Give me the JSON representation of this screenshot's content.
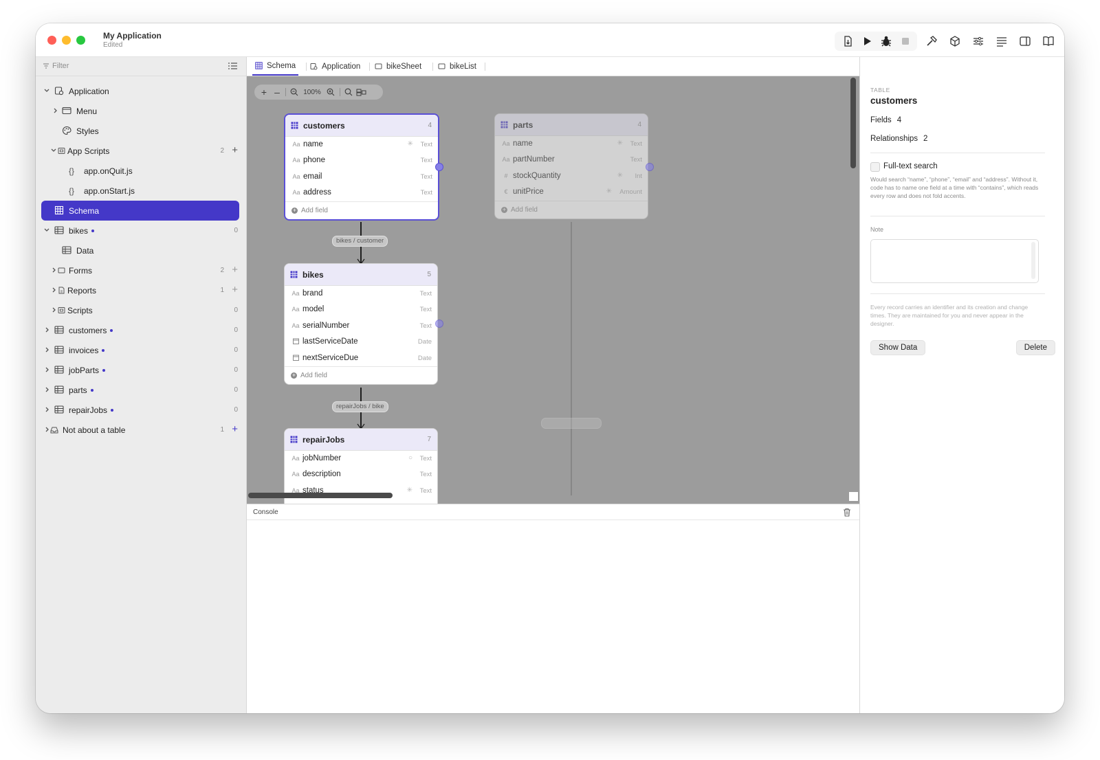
{
  "window": {
    "title": "My Application",
    "subtitle": "Edited"
  },
  "toolbar": {
    "icons": [
      "export-icon",
      "play-icon",
      "bug-icon",
      "stop-icon",
      "hammer-icon",
      "package-icon",
      "sliders-icon",
      "text-align-icon",
      "sidebar-toggle-icon",
      "book-icon"
    ]
  },
  "sidebar": {
    "filter_placeholder": "Filter",
    "items": [
      {
        "label": "Application",
        "count": ""
      },
      {
        "label": "Menu",
        "count": ""
      },
      {
        "label": "Styles",
        "count": ""
      },
      {
        "label": "App Scripts",
        "count": "2"
      },
      {
        "label": "app.onQuit.js",
        "count": ""
      },
      {
        "label": "app.onStart.js",
        "count": ""
      },
      {
        "label": "Schema",
        "count": ""
      },
      {
        "label": "bikes",
        "count": "0"
      },
      {
        "label": "Data",
        "count": ""
      },
      {
        "label": "Forms",
        "count": "2"
      },
      {
        "label": "Reports",
        "count": "1"
      },
      {
        "label": "Scripts",
        "count": "0"
      },
      {
        "label": "customers",
        "count": "0"
      },
      {
        "label": "invoices",
        "count": "0"
      },
      {
        "label": "jobParts",
        "count": "0"
      },
      {
        "label": "parts",
        "count": "0"
      },
      {
        "label": "repairJobs",
        "count": "0"
      },
      {
        "label": "Not about a table",
        "count": "1"
      }
    ]
  },
  "tabs": [
    "Schema",
    "Application",
    "bikeSheet",
    "bikeList"
  ],
  "zoom": {
    "level": "100%"
  },
  "tables": {
    "customers": {
      "name": "customers",
      "count": "4",
      "fields": [
        {
          "icon": "Aa",
          "name": "name",
          "type": "Text"
        },
        {
          "icon": "Aa",
          "name": "phone",
          "type": "Text"
        },
        {
          "icon": "Aa",
          "name": "email",
          "type": "Text"
        },
        {
          "icon": "Aa",
          "name": "address",
          "type": "Text"
        }
      ],
      "add_field": "Add field"
    },
    "parts": {
      "name": "parts",
      "count": "4",
      "fields": [
        {
          "icon": "Aa",
          "name": "name",
          "type": "Text"
        },
        {
          "icon": "Aa",
          "name": "partNumber",
          "type": "Text"
        },
        {
          "icon": "#",
          "name": "stockQuantity",
          "type": "Int"
        },
        {
          "icon": "€",
          "name": "unitPrice",
          "type": "Amount"
        }
      ],
      "add_field": "Add field"
    },
    "bikes": {
      "name": "bikes",
      "count": "5",
      "fields": [
        {
          "icon": "Aa",
          "name": "brand",
          "type": "Text"
        },
        {
          "icon": "Aa",
          "name": "model",
          "type": "Text"
        },
        {
          "icon": "Aa",
          "name": "serialNumber",
          "type": "Text"
        },
        {
          "icon": "cal",
          "name": "lastServiceDate",
          "type": "Date"
        },
        {
          "icon": "cal",
          "name": "nextServiceDue",
          "type": "Date"
        }
      ],
      "add_field": "Add field"
    },
    "repairJobs": {
      "name": "repairJobs",
      "count": "7",
      "fields": [
        {
          "icon": "Aa",
          "name": "jobNumber",
          "type": "Text"
        },
        {
          "icon": "Aa",
          "name": "description",
          "type": "Text"
        },
        {
          "icon": "Aa",
          "name": "status",
          "type": "Text"
        }
      ]
    }
  },
  "relations": {
    "customer": "bikes / customer",
    "bike": "repairJobs / bike"
  },
  "console": {
    "title": "Console"
  },
  "inspector": {
    "caption": "TABLE",
    "title": "customers",
    "fields_label": "Fields",
    "fields_value": "4",
    "relationships_label": "Relationships",
    "relationships_value": "2",
    "fulltext_label": "Full-text search",
    "fulltext_help": "Would search “name”, “phone”, “email” and “address”. Without it, code has to name one field at a time with “contains”, which reads every row and does not fold accents.",
    "note_label": "Note",
    "record_help": "Every record carries an identifier and its creation and change times. They are maintained for you and never appear in the designer.",
    "show_data": "Show Data",
    "delete": "Delete"
  },
  "colors": {
    "accent": "#4438c8",
    "canvas": "#9c9c9c",
    "sidebar": "#ececec"
  }
}
